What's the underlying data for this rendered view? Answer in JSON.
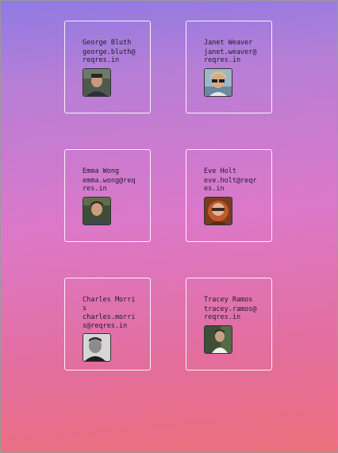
{
  "users": [
    {
      "name": "George Bluth",
      "email": "george.bluth@reqres.in"
    },
    {
      "name": "Janet Weaver",
      "email": "janet.weaver@reqres.in"
    },
    {
      "name": "Emma Wong",
      "email": "emma.wong@reqres.in"
    },
    {
      "name": "Eve Holt",
      "email": "eve.holt@reqres.in"
    },
    {
      "name": "Charles Morris",
      "email": "charles.morris@reqres.in"
    },
    {
      "name": "Tracey Ramos",
      "email": "tracey.ramos@reqres.in"
    }
  ]
}
